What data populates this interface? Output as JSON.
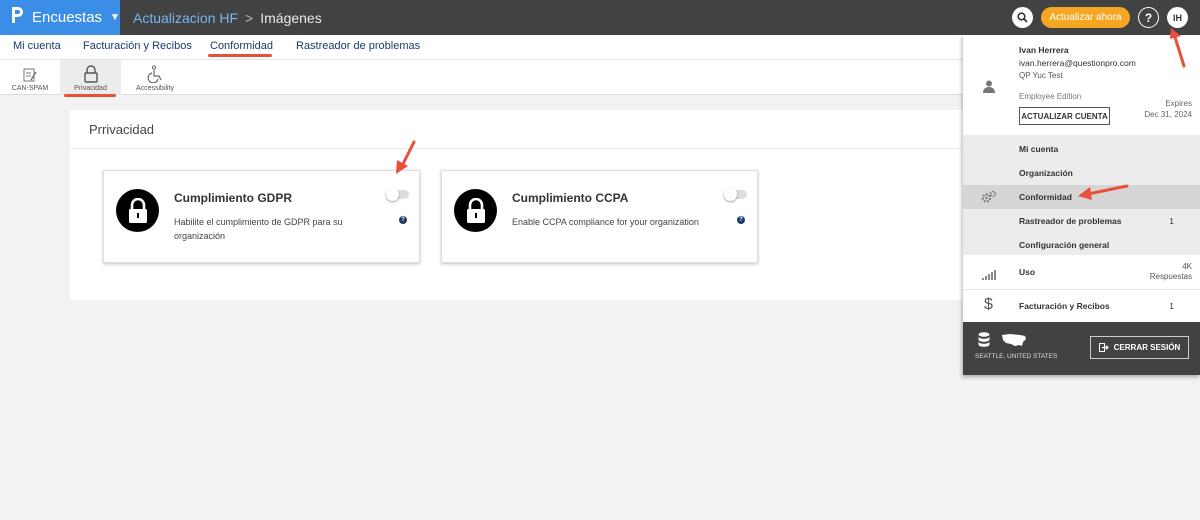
{
  "topbar": {
    "brand": "Encuestas",
    "crumb_project": "Actualizacion HF",
    "crumb_sep": ">",
    "crumb_page": "Imágenes",
    "upgrade_label": "Actualizar ahora",
    "help_label": "?",
    "avatar_initials": "IH"
  },
  "nav": {
    "items": [
      "Mi cuenta",
      "Facturación y Recibos",
      "Conformidad",
      "Rastreador de problemas"
    ]
  },
  "subnav": {
    "items": [
      "CAN-SPAM",
      "Privacidad",
      "Accessibility"
    ]
  },
  "content": {
    "title": "Prrivacidad",
    "cards": [
      {
        "title": "Cumplimiento GDPR",
        "desc": "Habilite el cumplimiento de GDPR para su organización"
      },
      {
        "title": "Cumplimiento CCPA",
        "desc": "Enable CCPA compliance for your organization"
      }
    ]
  },
  "panel": {
    "name": "Ivan Herrera",
    "email": "ivan.herrera@questionpro.com",
    "org": "QP Yuc Test",
    "edition": "Employee Edition",
    "upgrade_label": "ACTUALIZAR CUENTA",
    "expires_label": "Expires",
    "expires_date": "Dec 31, 2024",
    "menu": [
      {
        "label": "Mi cuenta",
        "count": ""
      },
      {
        "label": "Organización",
        "count": ""
      },
      {
        "label": "Conformidad",
        "count": ""
      },
      {
        "label": "Rastreador de problemas",
        "count": "1"
      },
      {
        "label": "Configuración general",
        "count": ""
      }
    ],
    "usage_label": "Uso",
    "usage_value": "4K",
    "usage_unit": "Respuestas",
    "billing_label": "Facturación y Recibos",
    "billing_count": "1",
    "location": "SEATTLE, UNITED STATES",
    "logout_label": "CERRAR SESIÓN"
  },
  "colors": {
    "topbar": "#424242",
    "brand": "#3b8ee5",
    "upgrade": "#f5a623",
    "nav_text": "#1d3a68",
    "annotation": "#e8503a"
  }
}
